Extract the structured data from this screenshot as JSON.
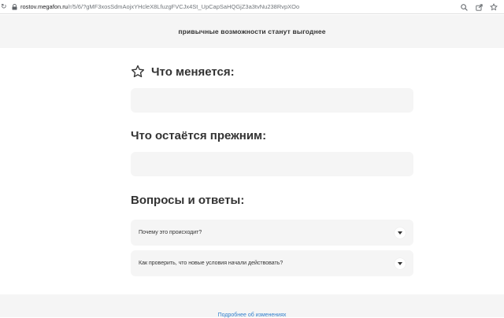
{
  "browser": {
    "url_host": "rostov.megafon.ru",
    "url_path": "/r/5/6/?gMF3xosSdmAojxYHcleX8LfuzgFVCJx4St_UpCapSaHQGjZ3a3tvNu238RvpXOo",
    "icons": [
      "reload-icon",
      "lock-icon",
      "zoom-icon",
      "share-icon",
      "bookmark-star-icon"
    ]
  },
  "banner": {
    "text": "привычные возможности станут выгоднее"
  },
  "sections": {
    "changes_title": "Что меняется:",
    "unchanged_title": "Что остаётся прежним:",
    "faq_title": "Вопросы и ответы:"
  },
  "faq": {
    "items": [
      {
        "question": "Почему это происходит?"
      },
      {
        "question": "Как проверить, что новые условия начали действовать?"
      }
    ]
  },
  "footer": {
    "link": "Подробнее об изменениях"
  },
  "colors": {
    "panel": "#f5f5f5",
    "text": "#333333",
    "link": "#3380cc"
  }
}
